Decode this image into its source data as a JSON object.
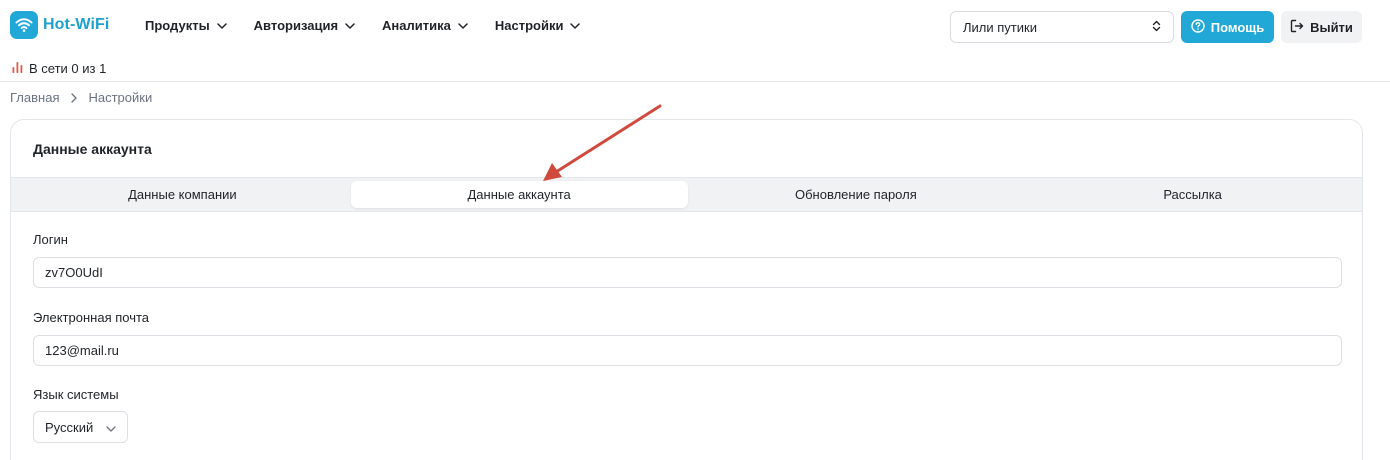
{
  "brand": {
    "name": "Hot-WiFi",
    "color": "#22a8d6"
  },
  "nav": {
    "items": [
      {
        "label": "Продукты"
      },
      {
        "label": "Авторизация"
      },
      {
        "label": "Аналитика"
      },
      {
        "label": "Настройки"
      }
    ],
    "account_select": "Лили путики",
    "help_label": "Помощь",
    "logout_label": "Выйти"
  },
  "status": {
    "text": "В сети 0 из 1",
    "icon": "signal-bars-icon"
  },
  "breadcrumb": {
    "items": [
      "Главная",
      "Настройки"
    ]
  },
  "card": {
    "title": "Данные аккаунта",
    "tabs": [
      {
        "label": "Данные компании",
        "active": false
      },
      {
        "label": "Данные аккаунта",
        "active": true
      },
      {
        "label": "Обновление пароля",
        "active": false
      },
      {
        "label": "Рассылка",
        "active": false
      }
    ],
    "fields": {
      "login": {
        "label": "Логин",
        "value": "zv7O0UdI"
      },
      "email": {
        "label": "Электронная почта",
        "value": "123@mail.ru"
      },
      "language": {
        "label": "Язык системы",
        "value": "Русский"
      }
    }
  },
  "annotation": {
    "color": "#cf4a3c",
    "icon": "red-arrow-annotation"
  }
}
